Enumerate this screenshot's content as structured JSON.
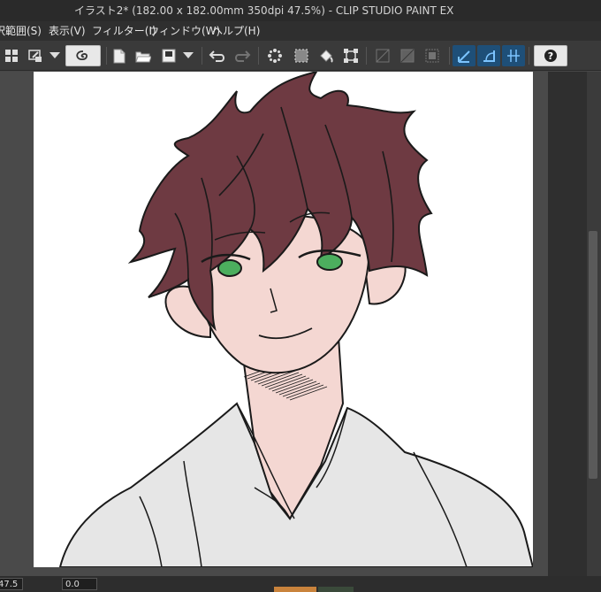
{
  "window": {
    "title": "イラスト2* (182.00 x 182.00mm 350dpi 47.5%)  - CLIP STUDIO PAINT EX"
  },
  "menu": [
    {
      "id": "selection",
      "label": "選択範囲(S)"
    },
    {
      "id": "view",
      "label": "表示(V)"
    },
    {
      "id": "filter",
      "label": "フィルター(I)"
    },
    {
      "id": "window",
      "label": "ウィンドウ(W)"
    },
    {
      "id": "help",
      "label": "ヘルプ(H)"
    }
  ],
  "toolbar_icons": [
    "layout-grid-icon",
    "screen-mode-icon",
    "dropdown-arrow-icon",
    "clip-studio-logo-icon",
    "new-file-icon",
    "open-folder-icon",
    "save-icon",
    "dropdown-arrow-icon",
    "undo-icon",
    "redo-icon",
    "clear-selection-icon",
    "select-all-icon",
    "fill-icon",
    "transform-icon",
    "grid-icon-1",
    "grid-icon-2",
    "grid-icon-3",
    "ruler-snap-icon",
    "special-ruler-snap-icon",
    "grid-snap-icon",
    "help-icon"
  ],
  "status": {
    "zoom": "47.5",
    "rotation": "0.0"
  },
  "colors": {
    "hair": "#6e3a42",
    "skin": "#f4d7d2",
    "eyes": "#4cae5e",
    "kimono": "#e6e6e6",
    "line": "#1a1a1a"
  }
}
